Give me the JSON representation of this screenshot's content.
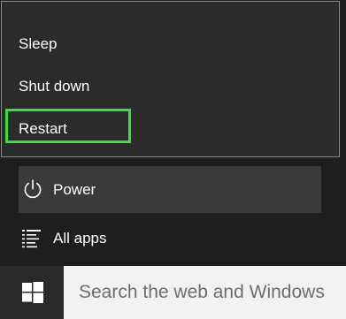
{
  "power_menu": {
    "items": [
      {
        "label": "Sleep"
      },
      {
        "label": "Shut down"
      },
      {
        "label": "Restart"
      }
    ],
    "highlight_color": "#33e33a"
  },
  "start_menu": {
    "power_label": "Power",
    "power_icon": "power-icon",
    "all_apps_label": "All apps",
    "all_apps_icon": "list-icon"
  },
  "taskbar": {
    "start_icon": "windows-logo-icon",
    "search_placeholder": "Search the web and Windows"
  }
}
